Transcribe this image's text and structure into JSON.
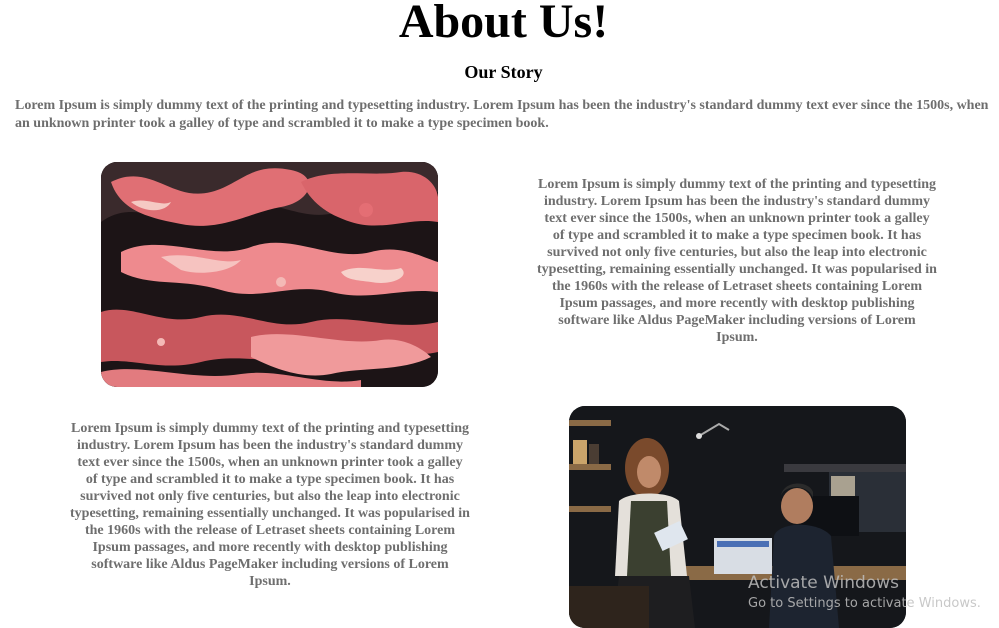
{
  "page": {
    "title": "About Us!",
    "section_heading": "Our Story",
    "intro": "Lorem Ipsum is simply dummy text of the printing and typesetting industry. Lorem Ipsum has been the industry's standard dummy text ever since the 1500s, when an unknown printer took a galley of type and scrambled it to make a type specimen book."
  },
  "story_blocks": [
    {
      "text": "Lorem Ipsum is simply dummy text of the printing and typesetting industry. Lorem Ipsum has been the industry's standard dummy text ever since the 1500s, when an unknown printer took a galley of type and scrambled it to make a type specimen book. It has survived not only five centuries, but also the leap into electronic typesetting, remaining essentially unchanged. It was popularised in the 1960s with the release of Letraset sheets containing Lorem Ipsum passages, and more recently with desktop publishing software like Aldus PageMaker including versions of Lorem Ipsum."
    },
    {
      "text": "Lorem Ipsum is simply dummy text of the printing and typesetting industry. Lorem Ipsum has been the industry's standard dummy text ever since the 1500s, when an unknown printer took a galley of type and scrambled it to make a type specimen book. It has survived not only five centuries, but also the leap into electronic typesetting, remaining essentially unchanged. It was popularised in the 1960s with the release of Letraset sheets containing Lorem Ipsum passages, and more recently with desktop publishing software like Aldus PageMaker including versions of Lorem Ipsum."
    }
  ],
  "windows_watermark": {
    "title": "Activate Windows",
    "subtitle": "Go to Settings to activate Windows."
  },
  "colors": {
    "title": "#000000",
    "body_text": "#6e6e6e",
    "marble_pink": "#e8757a",
    "marble_dark": "#1c1416"
  }
}
